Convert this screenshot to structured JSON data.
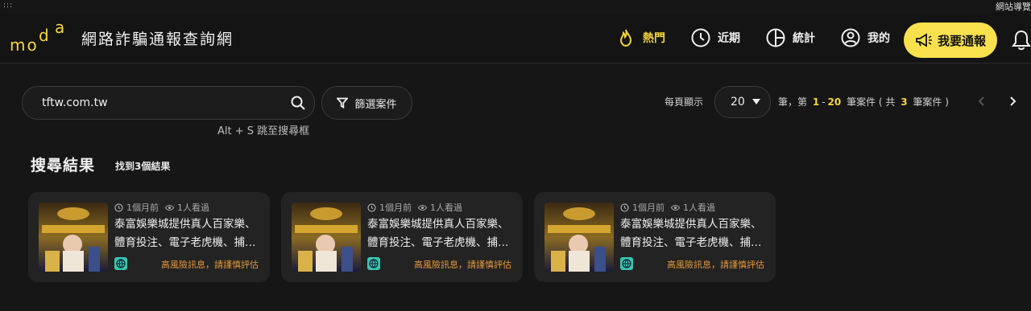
{
  "top_nav": {
    "site_guide": "網站導覽"
  },
  "header": {
    "logo_text": "moda",
    "site_title": "網路詐騙通報查詢網",
    "nav": [
      {
        "label": "熱門",
        "icon": "flame-icon"
      },
      {
        "label": "近期",
        "icon": "clock-icon"
      },
      {
        "label": "統計",
        "icon": "pie-chart-icon"
      },
      {
        "label": "我的",
        "icon": "user-icon"
      }
    ],
    "report_button": "我要通報",
    "colors": {
      "accent": "#f8e14d",
      "hot": "#f6d53a",
      "bg": "#161616"
    }
  },
  "search": {
    "value": "tftw.com.tw",
    "hint": "Alt + S 跳至搜尋框",
    "filter_label": "篩選案件"
  },
  "pager": {
    "per_page_label": "每頁顯示",
    "per_page_value": "20",
    "range_prefix": "筆，第",
    "range_start": "1",
    "range_dash": "-",
    "range_end": "20",
    "range_mid": "筆案件 ( 共",
    "total": "3",
    "range_suffix": "筆案件 )"
  },
  "results": {
    "title": "搜尋結果",
    "count_text": "找到3個結果",
    "cards": [
      {
        "time": "1個月前",
        "views": "1人看過",
        "title": "泰富娛樂城提供真人百家樂、體育投注、電子老虎機、捕…",
        "warning": "高風險訊息，請謹慎評估"
      },
      {
        "time": "1個月前",
        "views": "1人看過",
        "title": "泰富娛樂城提供真人百家樂、體育投注、電子老虎機、捕…",
        "warning": "高風險訊息，請謹慎評估"
      },
      {
        "time": "1個月前",
        "views": "1人看過",
        "title": "泰富娛樂城提供真人百家樂、體育投注、電子老虎機、捕…",
        "warning": "高風險訊息，請謹慎評估"
      }
    ]
  }
}
